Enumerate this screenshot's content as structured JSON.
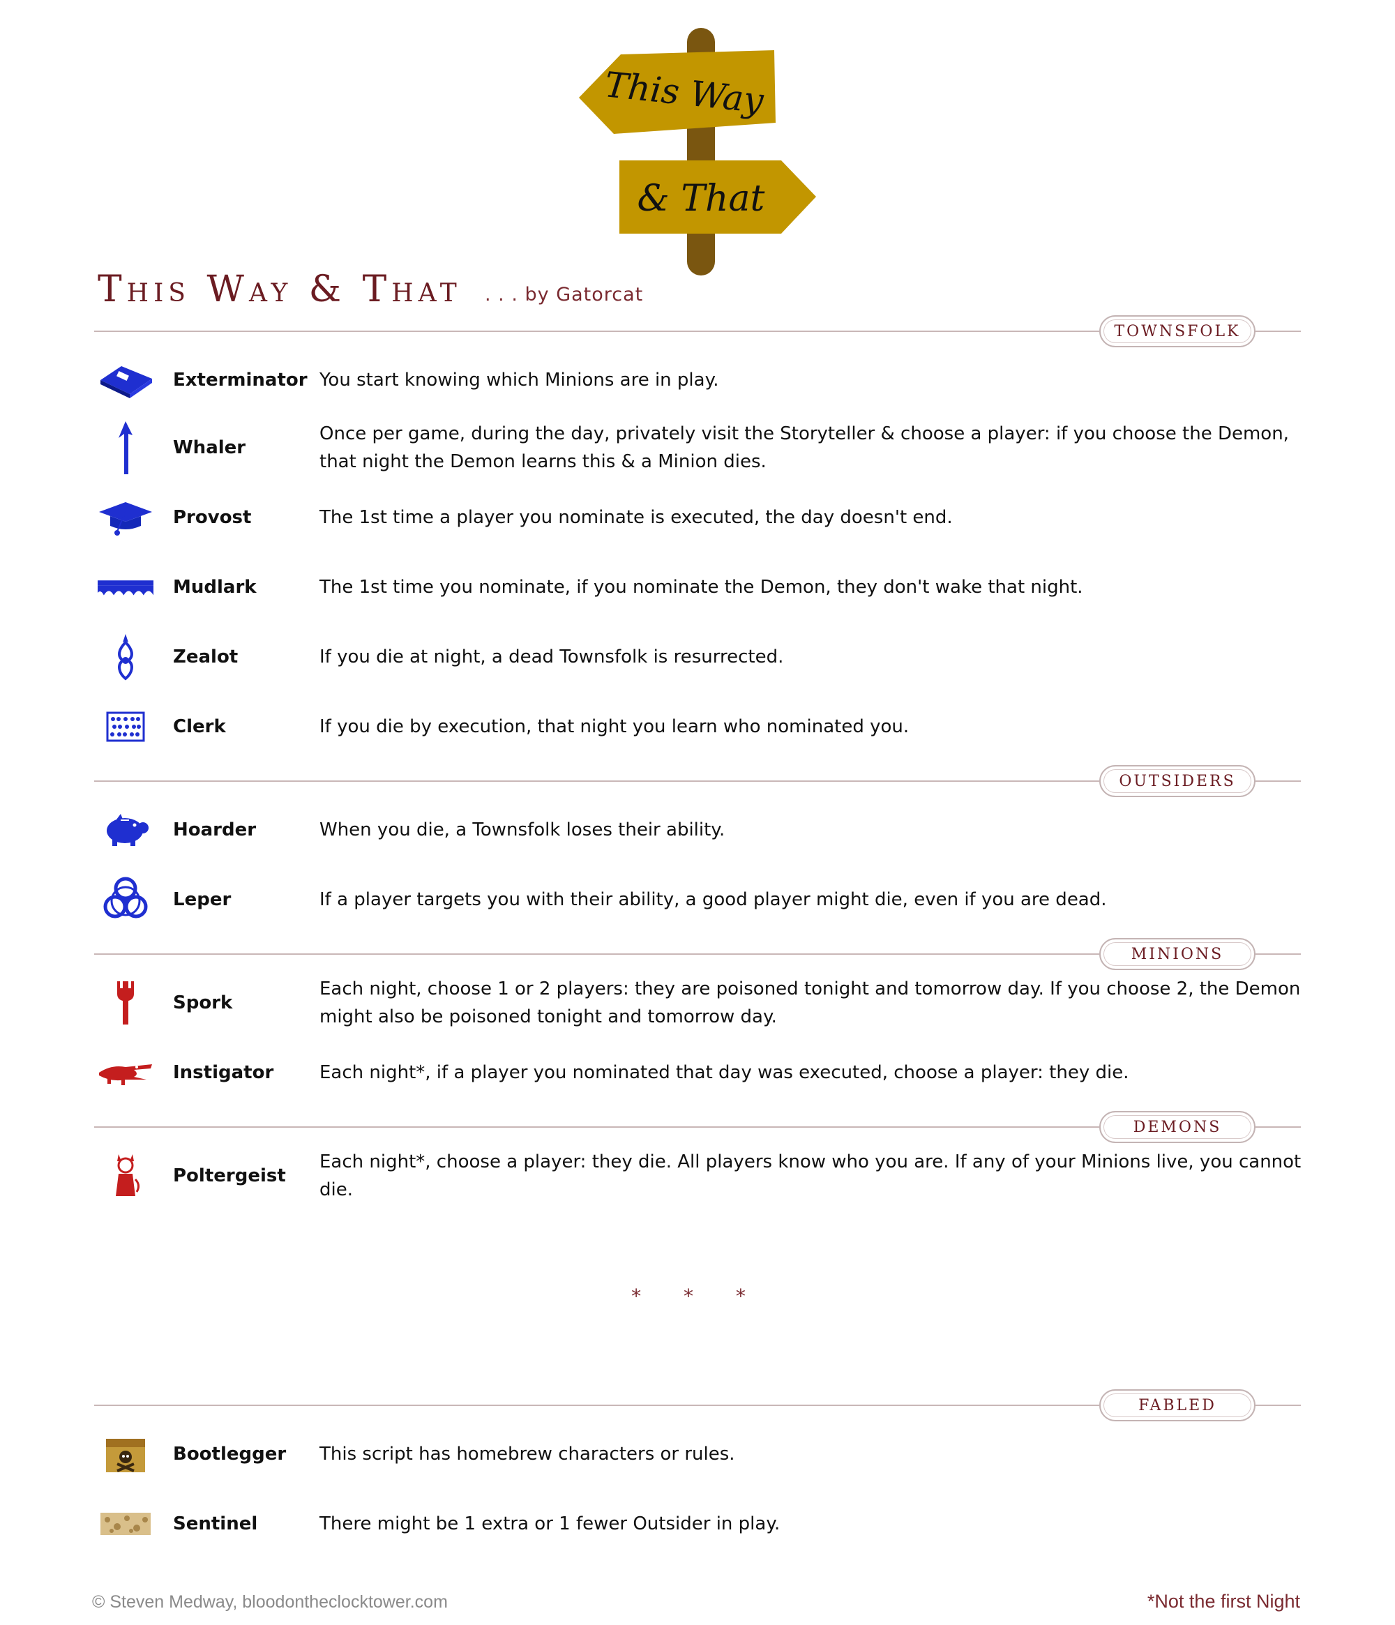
{
  "logo": {
    "line1": "This Way",
    "line2": "& That"
  },
  "header": {
    "title": "This Way & That",
    "author": ". . . by Gatorcat"
  },
  "colors": {
    "good": "#1f2fd0",
    "evil": "#c41e1e",
    "accent": "#6b1c22",
    "sign": "#c29600",
    "post": "#7a5610"
  },
  "sections": {
    "townsfolk": "Townsfolk",
    "outsiders": "Outsiders",
    "minions": "Minions",
    "demons": "Demons",
    "fabled": "Fabled"
  },
  "townsfolk": [
    {
      "name": "Exterminator",
      "icon": "book-icon",
      "ability": "You start knowing which Minions are in play."
    },
    {
      "name": "Whaler",
      "icon": "harpoon-icon",
      "ability": "Once per game, during the day, privately visit the Storyteller & choose a player: if you choose the Demon, that night the Demon learns this & a Minion dies."
    },
    {
      "name": "Provost",
      "icon": "mortarboard-icon",
      "ability": "The 1st time a player you nominate is executed, the day doesn't end."
    },
    {
      "name": "Mudlark",
      "icon": "bridge-icon",
      "ability": "The 1st time you nominate, if you nominate the Demon, they don't wake that night."
    },
    {
      "name": "Zealot",
      "icon": "amulet-icon",
      "ability": "If you die at night, a dead Townsfolk is resurrected."
    },
    {
      "name": "Clerk",
      "icon": "abacus-icon",
      "ability": "If you die by execution, that night you learn who nominated you."
    }
  ],
  "outsiders": [
    {
      "name": "Hoarder",
      "icon": "piggy-bank-icon",
      "ability": "When you die, a Townsfolk loses their ability."
    },
    {
      "name": "Leper",
      "icon": "biohazard-icon",
      "ability": "If a player targets you with their ability, a good player might die, even if you are dead."
    }
  ],
  "minions": [
    {
      "name": "Spork",
      "icon": "spork-icon",
      "ability": "Each night, choose 1 or 2 players: they are poisoned tonight and tomorrow day. If you choose 2, the Demon might also be poisoned tonight and tomorrow day."
    },
    {
      "name": "Instigator",
      "icon": "crocodile-icon",
      "ability": "Each night*, if a player you nominated that day was executed, choose a player: they die."
    }
  ],
  "demons": [
    {
      "name": "Poltergeist",
      "icon": "devil-icon",
      "ability": "Each night*, choose a player: they die. All players know who you are. If any of your Minions live, you cannot die."
    }
  ],
  "separator": "* * *",
  "fabled": [
    {
      "name": "Bootlegger",
      "icon": "pirate-chest-icon",
      "ability": "This script has homebrew characters or rules."
    },
    {
      "name": "Sentinel",
      "icon": "rubble-icon",
      "ability": "There might be 1 extra or 1 fewer Outsider in play."
    }
  ],
  "footer": {
    "copyright": "© Steven Medway, bloodontheclocktower.com",
    "note": "*Not the first Night"
  }
}
